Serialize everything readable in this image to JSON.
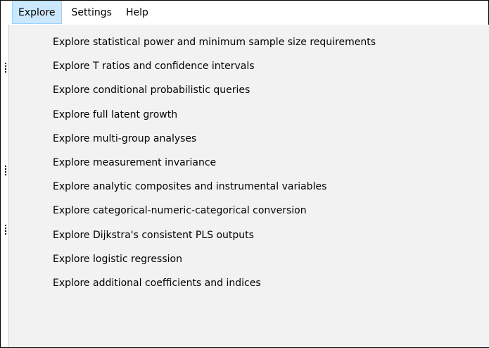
{
  "menubar": {
    "items": [
      {
        "label": "Explore"
      },
      {
        "label": "Settings"
      },
      {
        "label": "Help"
      }
    ]
  },
  "explore_menu": {
    "items": [
      {
        "label": "Explore statistical power and minimum sample size requirements"
      },
      {
        "label": "Explore T ratios and confidence intervals"
      },
      {
        "label": "Explore conditional probabilistic queries"
      },
      {
        "label": "Explore full latent growth"
      },
      {
        "label": "Explore multi-group analyses"
      },
      {
        "label": "Explore measurement invariance"
      },
      {
        "label": "Explore analytic composites and instrumental variables"
      },
      {
        "label": "Explore categorical-numeric-categorical conversion"
      },
      {
        "label": "Explore Dijkstra's consistent PLS outputs"
      },
      {
        "label": "Explore logistic regression"
      },
      {
        "label": "Explore additional coefficients and indices"
      }
    ]
  },
  "colors": {
    "menubar_bg": "#ffffff",
    "active_item_bg": "#cce8ff",
    "active_item_border": "#99d1ff",
    "dropdown_bg": "#f2f2f2",
    "text": "#000000"
  }
}
